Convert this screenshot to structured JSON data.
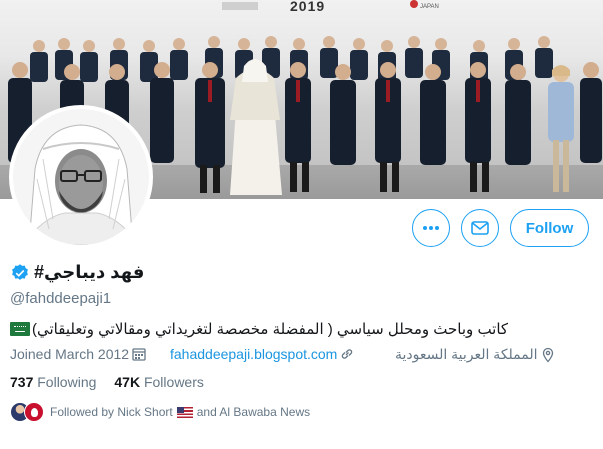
{
  "banner": {
    "year_text": "2019",
    "location_text": "JAPAN"
  },
  "profile": {
    "display_name": "فهد ديباجي#",
    "handle": "@fahddeepaji1",
    "bio": "كاتب وباحث ومحلل سياسي ( المفضلة مخصصة لتغريداتي ومقالاتي وتعليقاتي)",
    "joined": "Joined March 2012",
    "website": "fahaddeepaji.blogspot.com",
    "location": "المملكة العربية السعودية",
    "verified": true
  },
  "actions": {
    "more_icon": "more-horizontal-icon",
    "message_icon": "envelope-icon",
    "follow_label": "Follow"
  },
  "stats": {
    "following_count": "737",
    "following_label": "Following",
    "followers_count": "47K",
    "followers_label": "Followers"
  },
  "followed_by": {
    "prefix": "Followed by Nick Short",
    "suffix": "and Al Bawaba News"
  },
  "colors": {
    "accent": "#1da1f2",
    "link": "#1b95e0",
    "secondary_text": "#657786",
    "primary_text": "#14171a"
  }
}
